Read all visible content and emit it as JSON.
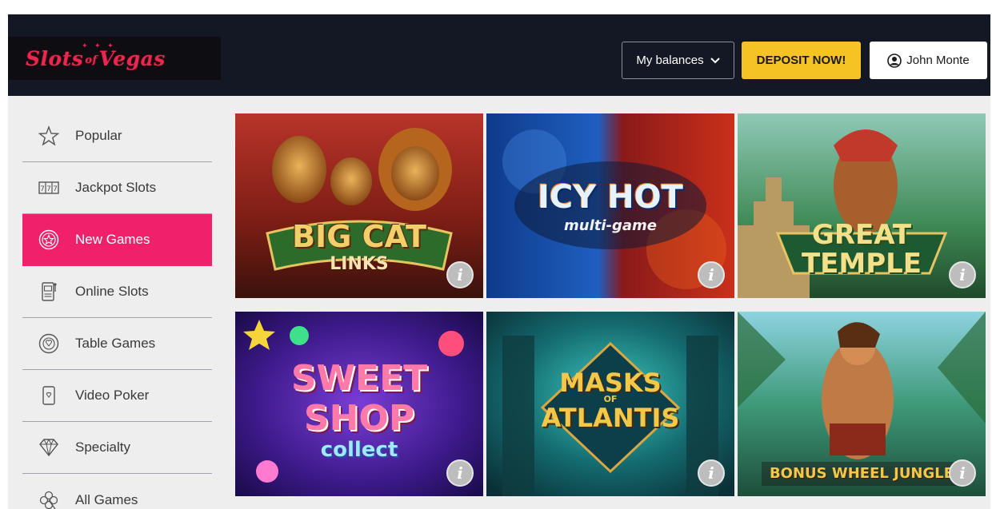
{
  "header": {
    "logo_text": "Slots of Vegas",
    "logo_main": "Slots",
    "logo_mid": "of",
    "logo_end": "Vegas",
    "balances_label": "My balances",
    "deposit_label": "DEPOSIT NOW!",
    "user_name": "John Monte"
  },
  "sidebar": {
    "items": [
      {
        "label": "Popular",
        "icon": "star-icon"
      },
      {
        "label": "Jackpot Slots",
        "icon": "slot-reels-icon"
      },
      {
        "label": "New Games",
        "icon": "new-star-badge-icon",
        "active": true
      },
      {
        "label": "Online Slots",
        "icon": "slot-machine-icon"
      },
      {
        "label": "Table Games",
        "icon": "poker-chip-icon"
      },
      {
        "label": "Video Poker",
        "icon": "playing-card-icon"
      },
      {
        "label": "Specialty",
        "icon": "diamond-icon"
      },
      {
        "label": "All Games",
        "icon": "clover-icon"
      }
    ]
  },
  "games": [
    {
      "title_line1": "BIG CAT",
      "title_line2": "LINKS"
    },
    {
      "title_line1": "ICY HOT",
      "title_line2": "multi-game"
    },
    {
      "title_line1": "GREAT",
      "title_line2": "TEMPLE"
    },
    {
      "title_line1": "SWEET",
      "title_line2": "SHOP",
      "title_line3": "collect"
    },
    {
      "title_line1": "MASKS",
      "title_line2": "ATLANTIS",
      "title_small": "OF"
    },
    {
      "title_line1": "BONUS WHEEL JUNGLE"
    }
  ],
  "info_glyph": "i",
  "colors": {
    "topbar": "#141824",
    "brand": "#e8294f",
    "active_nav": "#f0216a",
    "deposit": "#f6c324"
  }
}
